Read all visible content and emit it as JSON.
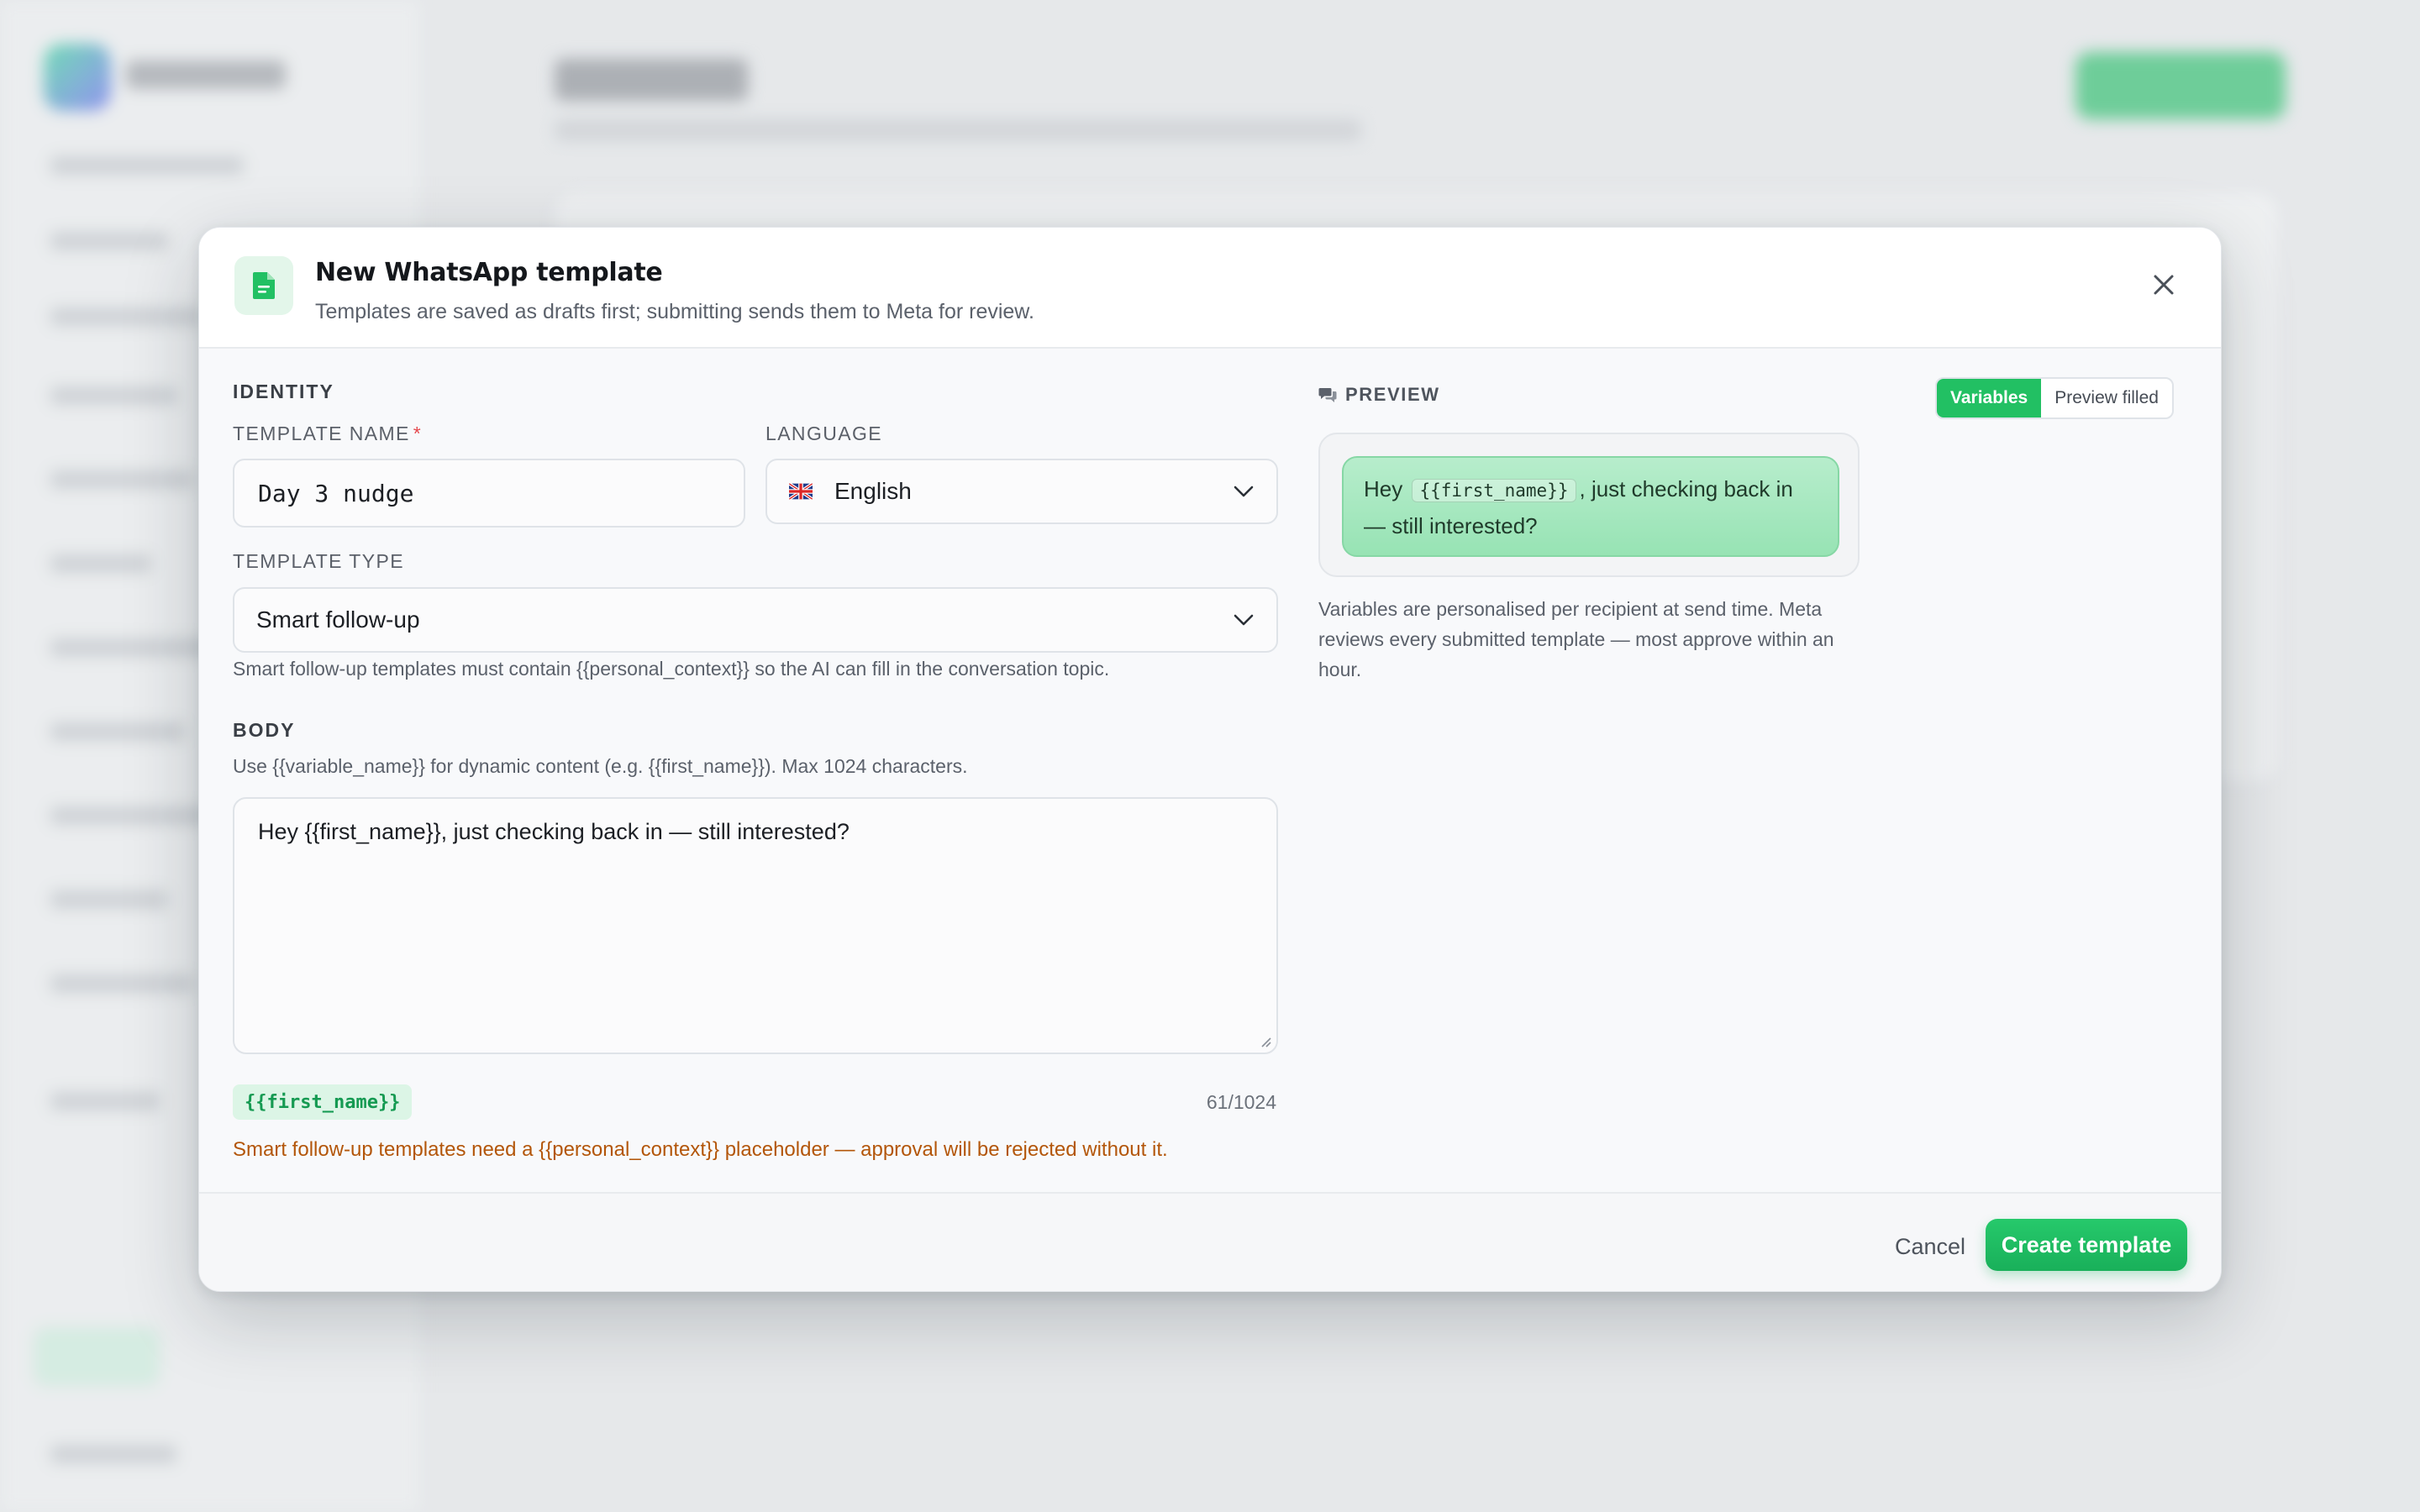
{
  "modal": {
    "title": "New WhatsApp template",
    "subtitle": "Templates are saved as drafts first; submitting sends them to Meta for review.",
    "icon": "document-icon",
    "close_icon": "close-icon"
  },
  "identity": {
    "section_label": "IDENTITY",
    "template_name_label": "TEMPLATE NAME",
    "required_marker": "*",
    "template_name_value": "Day 3 nudge",
    "language_label": "LANGUAGE",
    "language_value": "English",
    "language_flag": "uk-flag-icon"
  },
  "template_type": {
    "label": "TEMPLATE TYPE",
    "value": "Smart follow-up",
    "help": "Smart follow-up templates must contain {{personal_context}} so the AI can fill in the conversation topic."
  },
  "body": {
    "section_label": "BODY",
    "help": "Use {{variable_name}} for dynamic content (e.g. {{first_name}}). Max 1024 characters.",
    "value": "Hey {{first_name}}, just checking back in — still interested?",
    "variable_chip": "{{first_name}}",
    "counter": "61/1024",
    "warning": "Smart follow-up templates need a {{personal_context}} placeholder — approval will be rejected without it."
  },
  "preview": {
    "label": "PREVIEW",
    "toggle_variables": "Variables",
    "toggle_filled": "Preview filled",
    "active_toggle": "Variables",
    "bubble_before": "Hey",
    "bubble_var": "{{first_name}}",
    "bubble_after": ", just checking back in — still interested?",
    "note": "Variables are personalised per recipient at send time. Meta reviews every submitted template — most approve within an hour."
  },
  "footer": {
    "cancel_label": "Cancel",
    "create_label": "Create template"
  },
  "colors": {
    "accent": "#22c063",
    "warning": "#b3560a",
    "chip_bg": "#dcf5e6"
  }
}
